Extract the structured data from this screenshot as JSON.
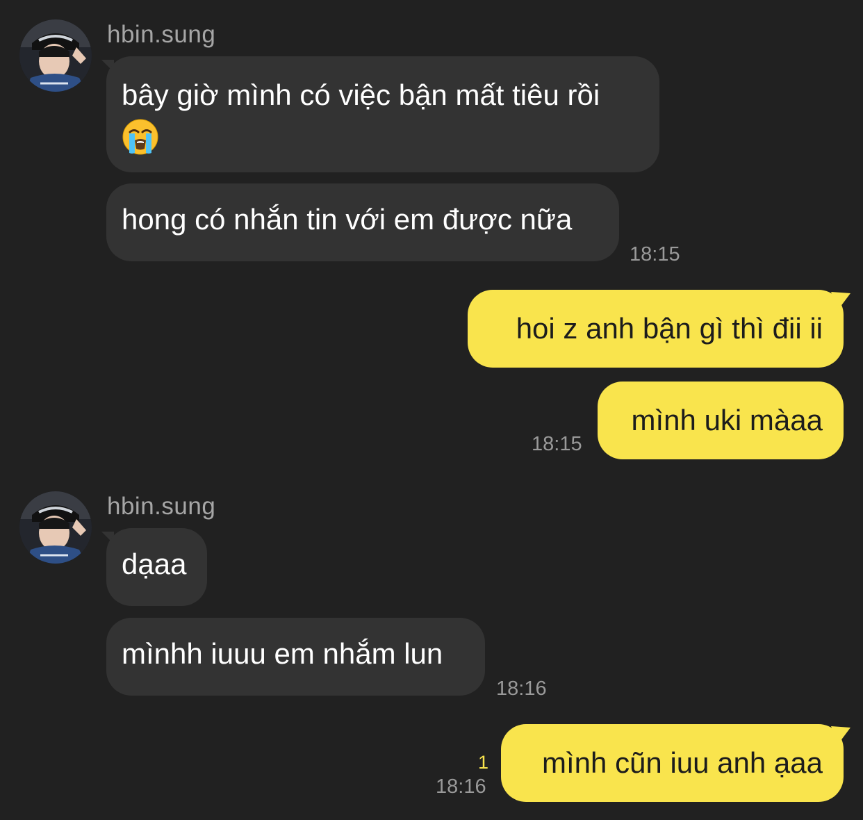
{
  "conversation": {
    "groups": [
      {
        "sender": "hbin.sung",
        "messages": [
          {
            "line1": "bây giờ mình có việc bận mất tiêu rồi",
            "emoji": "loudly-crying-face"
          },
          {
            "text": "hong có nhắn tin với em được nữa"
          }
        ],
        "time": "18:15"
      },
      {
        "messages": [
          {
            "text": "hoi z anh bận gì thì đii ii"
          },
          {
            "text": "mình uki màaa"
          }
        ],
        "time": "18:15"
      },
      {
        "sender": "hbin.sung",
        "messages": [
          {
            "text": "dạaa"
          },
          {
            "text": "mìnhh iuuu em nhắm lun"
          }
        ],
        "time": "18:16"
      },
      {
        "messages": [
          {
            "text": "mình cũn iuu anh ạaa"
          }
        ],
        "time": "18:16",
        "unread": "1"
      }
    ]
  },
  "colors": {
    "background": "#212121",
    "incoming_bubble": "#333333",
    "outgoing_bubble": "#f9e44d"
  }
}
